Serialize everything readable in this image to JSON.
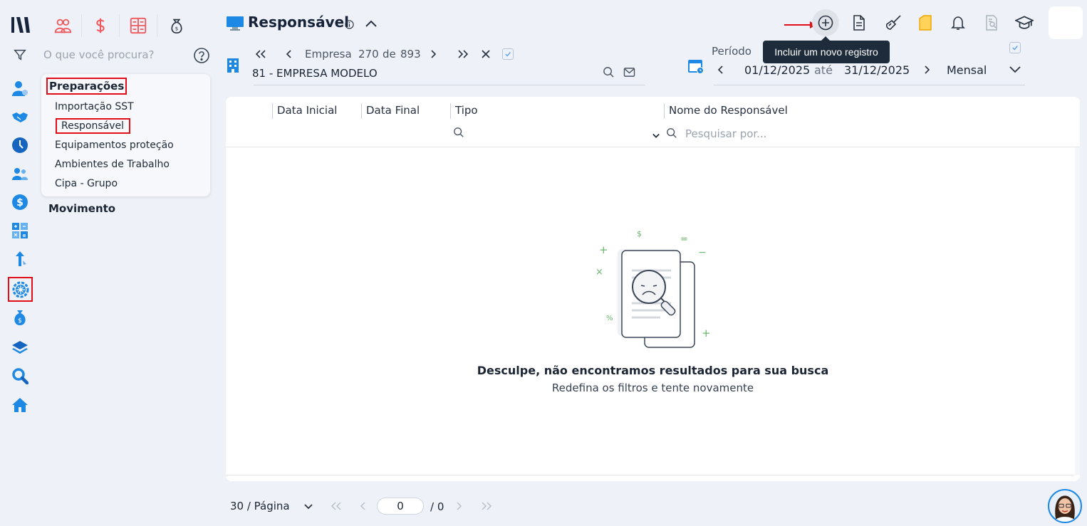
{
  "header": {
    "title": "Responsável",
    "tooltip": "Incluir um novo registro"
  },
  "search": {
    "placeholder": "O que você procura?"
  },
  "company_nav": {
    "label": "Empresa",
    "current": "270",
    "of_label": "de",
    "total": "893",
    "company_name": "81 - EMPRESA MODELO"
  },
  "period": {
    "label": "Período",
    "start": "01/12/2025",
    "between": "até",
    "end": "31/12/2025",
    "frequency": "Mensal"
  },
  "menu": {
    "section_title": "Preparações",
    "items": [
      {
        "label": "Importação SST"
      },
      {
        "label": "Responsável"
      },
      {
        "label": "Equipamentos proteção"
      },
      {
        "label": "Ambientes de Trabalho"
      },
      {
        "label": "Cipa - Grupo"
      }
    ],
    "section2_title": "Movimento"
  },
  "table": {
    "columns": [
      {
        "label": "Data Inicial"
      },
      {
        "label": "Data Final"
      },
      {
        "label": "Tipo"
      },
      {
        "label": "Nome do Responsável"
      }
    ],
    "filter_placeholder": "Pesquisar por..."
  },
  "empty_state": {
    "title": "Desculpe, não encontramos resultados para sua busca",
    "subtitle": "Redefina os filtros e tente novamente"
  },
  "pagination": {
    "page_size": "30 / Página",
    "current_page": "0",
    "total_pages": "/ 0"
  },
  "colors": {
    "accent": "#1e88e5",
    "highlight_box": "#e10d17",
    "module_red": "#f05a5e",
    "tooltip_bg": "#1d2b3a"
  },
  "icons": {
    "rail": [
      "filter-icon",
      "user-settings-icon",
      "handshake-icon",
      "clock-icon",
      "users-icon",
      "dollar-icon",
      "calculator-icon",
      "growth-arrow-icon",
      "gear-network-icon",
      "money-bag-icon",
      "layers-icon",
      "search-icon",
      "home-icon"
    ],
    "modules": [
      "people-icon",
      "dollar-icon",
      "grid-calc-icon",
      "money-bag-icon"
    ],
    "toolbar": [
      "add-circle-icon",
      "document-icon",
      "broom-icon",
      "note-icon",
      "bell-icon",
      "doc-search-icon",
      "graduation-cap-icon"
    ]
  }
}
